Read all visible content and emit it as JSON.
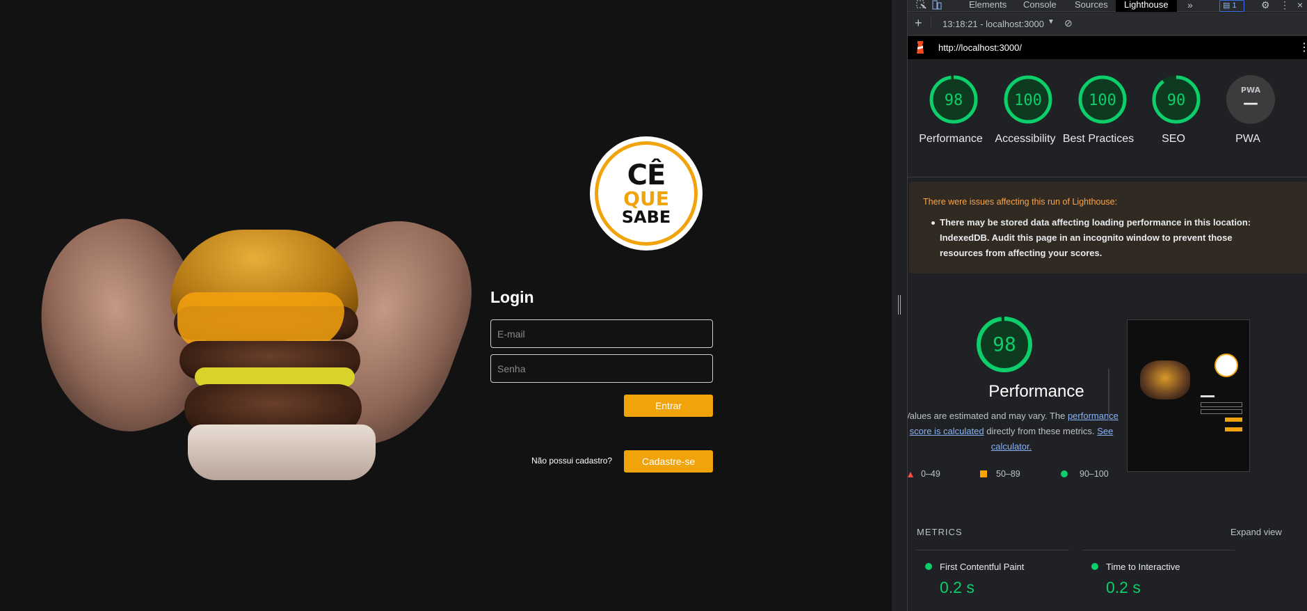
{
  "app": {
    "logo": {
      "line1": "CÊ",
      "line2": "QUE",
      "line3": "SABE"
    },
    "login": {
      "title": "Login",
      "email_placeholder": "E-mail",
      "password_placeholder": "Senha",
      "submit_label": "Entrar",
      "no_account_text": "Não possui cadastro?",
      "signup_label": "Cadastre-se"
    }
  },
  "devtools": {
    "tabs": [
      "Elements",
      "Console",
      "Sources",
      "Lighthouse"
    ],
    "active_tab": "Lighthouse",
    "issues_count": "1",
    "report_selector": "13:18:21 - localhost:3000",
    "url": "http://localhost:3000/",
    "scores": [
      {
        "label": "Performance",
        "value": "98",
        "color": "#0cce6b"
      },
      {
        "label": "Accessibility",
        "value": "100",
        "color": "#0cce6b"
      },
      {
        "label": "Best Practices",
        "value": "100",
        "color": "#0cce6b"
      },
      {
        "label": "SEO",
        "value": "90",
        "color": "#0cce6b"
      },
      {
        "label": "PWA",
        "value": "—",
        "color": "#e8eaed"
      }
    ],
    "issues": {
      "title": "There were issues affecting this run of Lighthouse:",
      "item": "There may be stored data affecting loading performance in this location: IndexedDB. Audit this page in an incognito window to prevent those resources from affecting your scores."
    },
    "performance": {
      "score": "98",
      "title": "Performance",
      "desc_prefix": "Values are estimated and may vary. The",
      "desc_link1": "performance score is calculated",
      "desc_middle": "directly from these metrics.",
      "desc_link2": "See calculator."
    },
    "legend": [
      "0–49",
      "50–89",
      "90–100"
    ],
    "metrics": {
      "title": "METRICS",
      "expand_label": "Expand view",
      "items": [
        {
          "name": "First Contentful Paint",
          "value": "0.2 s"
        },
        {
          "name": "Time to Interactive",
          "value": "0.2 s"
        }
      ]
    },
    "colors": {
      "pass": "#0cce6b",
      "average": "#ffa400",
      "fail": "#ff4e42",
      "accent": "#f0a30a"
    }
  }
}
